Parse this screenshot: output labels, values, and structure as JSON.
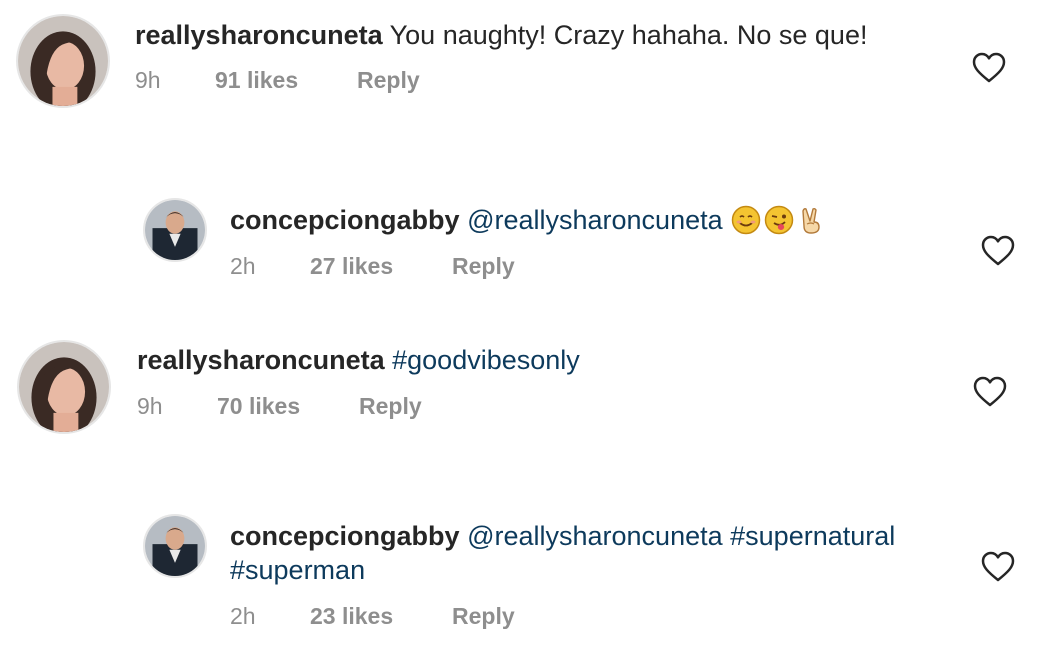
{
  "comments": [
    {
      "username": "reallysharoncuneta",
      "text": "You naughty! Crazy hahaha. No se que!",
      "time": "9h",
      "likes": "91 likes",
      "reply": "Reply"
    },
    {
      "username": "concepciongabby",
      "mention": "@reallysharoncuneta",
      "emojis": [
        "smiling-face-emoji",
        "winking-face-tongue-emoji",
        "victory-hand-emoji"
      ],
      "time": "2h",
      "likes": "27 likes",
      "reply": "Reply"
    },
    {
      "username": "reallysharoncuneta",
      "hashtag": "#goodvibesonly",
      "time": "9h",
      "likes": "70 likes",
      "reply": "Reply"
    },
    {
      "username": "concepciongabby",
      "mention": "@reallysharoncuneta",
      "hashtag1": "#supernatural",
      "hashtag2": "#superman",
      "time": "2h",
      "likes": "23 likes",
      "reply": "Reply"
    }
  ],
  "colors": {
    "text": "#262626",
    "meta": "#8e8e8e",
    "link": "#0d3a5c"
  }
}
